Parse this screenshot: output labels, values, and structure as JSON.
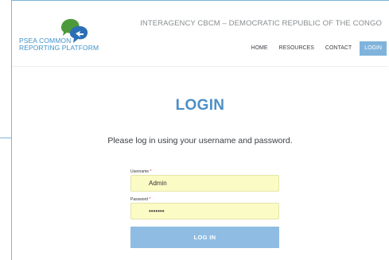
{
  "brand": {
    "line1": "PSEA COMMON",
    "line2": "REPORTING PLATFORM",
    "colors": {
      "green": "#4d9a3a",
      "blue": "#2a6fb5",
      "text": "#3f93c9"
    }
  },
  "header": {
    "org_title": "INTERAGENCY CBCM – DEMOCRATIC REPUBLIC OF THE CONGO"
  },
  "nav": {
    "items": [
      {
        "label": "HOME",
        "active": false
      },
      {
        "label": "RESOURCES",
        "active": false
      },
      {
        "label": "CONTACT",
        "active": false
      },
      {
        "label": "LOGIN",
        "active": true
      }
    ]
  },
  "login": {
    "title": "LOGIN",
    "intro": "Please log in using your username and password.",
    "username_label": "Username",
    "password_label": "Password",
    "required_marker": "*",
    "username_value": "Admin",
    "password_value": "•••••••",
    "submit_label": "LOG IN"
  },
  "colors": {
    "accent": "#4d8fc6",
    "button": "#8fbce2",
    "nav_active": "#7fb3dc",
    "input_bg": "#fbfbc6"
  }
}
